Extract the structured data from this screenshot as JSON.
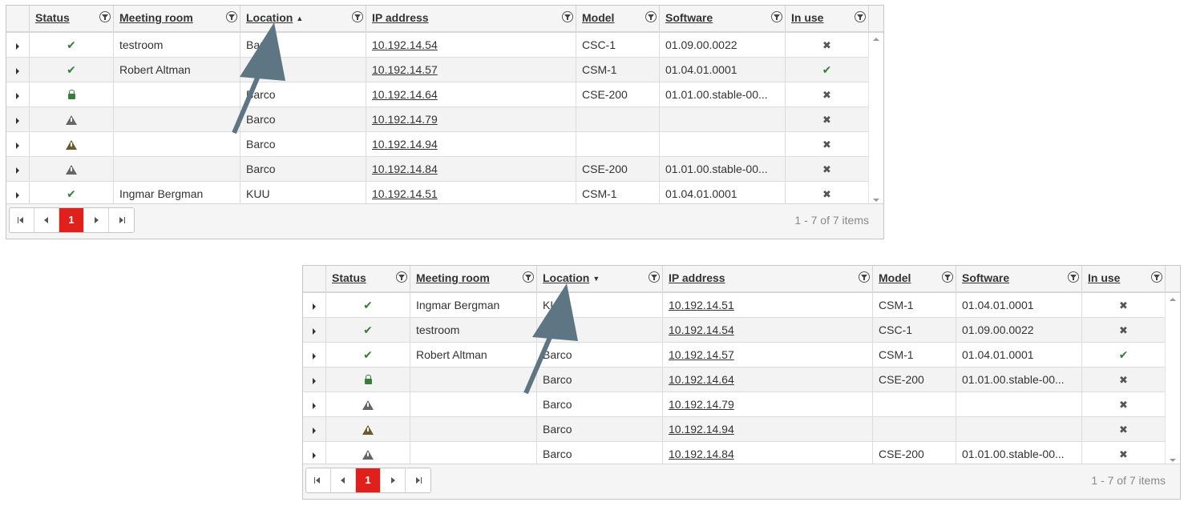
{
  "colors": {
    "accent": "#e0201c",
    "check": "#3a7d3a",
    "arrow": "#5e7584"
  },
  "grids": [
    {
      "headers": [
        {
          "label": "Status"
        },
        {
          "label": "Meeting room"
        },
        {
          "label": "Location",
          "sort": "▲"
        },
        {
          "label": "IP address"
        },
        {
          "label": "Model"
        },
        {
          "label": "Software"
        },
        {
          "label": "In use"
        }
      ],
      "rows": [
        {
          "status": "check",
          "room": "testroom",
          "location": "Barco",
          "ip": "10.192.14.54",
          "model": "CSC-1",
          "software": "01.09.00.0022",
          "inuse": "cross"
        },
        {
          "status": "check",
          "room": "Robert Altman",
          "location": "Barco",
          "ip": "10.192.14.57",
          "model": "CSM-1",
          "software": "01.04.01.0001",
          "inuse": "check"
        },
        {
          "status": "lock",
          "room": "",
          "location": "Barco",
          "ip": "10.192.14.64",
          "model": "CSE-200",
          "software": "01.01.00.stable-00...",
          "inuse": "cross"
        },
        {
          "status": "warn-gray",
          "room": "",
          "location": "Barco",
          "ip": "10.192.14.79",
          "model": "",
          "software": "",
          "inuse": "cross"
        },
        {
          "status": "warn-orange",
          "room": "",
          "location": "Barco",
          "ip": "10.192.14.94",
          "model": "",
          "software": "",
          "inuse": "cross"
        },
        {
          "status": "warn-gray",
          "room": "",
          "location": "Barco",
          "ip": "10.192.14.84",
          "model": "CSE-200",
          "software": "01.01.00.stable-00...",
          "inuse": "cross"
        },
        {
          "status": "check",
          "room": "Ingmar Bergman",
          "location": "KUU",
          "ip": "10.192.14.51",
          "model": "CSM-1",
          "software": "01.04.01.0001",
          "inuse": "cross"
        }
      ],
      "pager": {
        "page": "1",
        "info": "1 - 7 of 7 items"
      }
    },
    {
      "headers": [
        {
          "label": "Status"
        },
        {
          "label": "Meeting room"
        },
        {
          "label": "Location",
          "sort": "▼"
        },
        {
          "label": "IP address"
        },
        {
          "label": "Model"
        },
        {
          "label": "Software"
        },
        {
          "label": "In use"
        }
      ],
      "rows": [
        {
          "status": "check",
          "room": "Ingmar Bergman",
          "location": "KUU",
          "ip": "10.192.14.51",
          "model": "CSM-1",
          "software": "01.04.01.0001",
          "inuse": "cross"
        },
        {
          "status": "check",
          "room": "testroom",
          "location": "Barco",
          "ip": "10.192.14.54",
          "model": "CSC-1",
          "software": "01.09.00.0022",
          "inuse": "cross"
        },
        {
          "status": "check",
          "room": "Robert Altman",
          "location": "Barco",
          "ip": "10.192.14.57",
          "model": "CSM-1",
          "software": "01.04.01.0001",
          "inuse": "check"
        },
        {
          "status": "lock",
          "room": "",
          "location": "Barco",
          "ip": "10.192.14.64",
          "model": "CSE-200",
          "software": "01.01.00.stable-00...",
          "inuse": "cross"
        },
        {
          "status": "warn-gray",
          "room": "",
          "location": "Barco",
          "ip": "10.192.14.79",
          "model": "",
          "software": "",
          "inuse": "cross"
        },
        {
          "status": "warn-orange",
          "room": "",
          "location": "Barco",
          "ip": "10.192.14.94",
          "model": "",
          "software": "",
          "inuse": "cross"
        },
        {
          "status": "warn-gray",
          "room": "",
          "location": "Barco",
          "ip": "10.192.14.84",
          "model": "CSE-200",
          "software": "01.01.00.stable-00...",
          "inuse": "cross"
        }
      ],
      "pager": {
        "page": "1",
        "info": "1 - 7 of 7 items"
      }
    }
  ]
}
